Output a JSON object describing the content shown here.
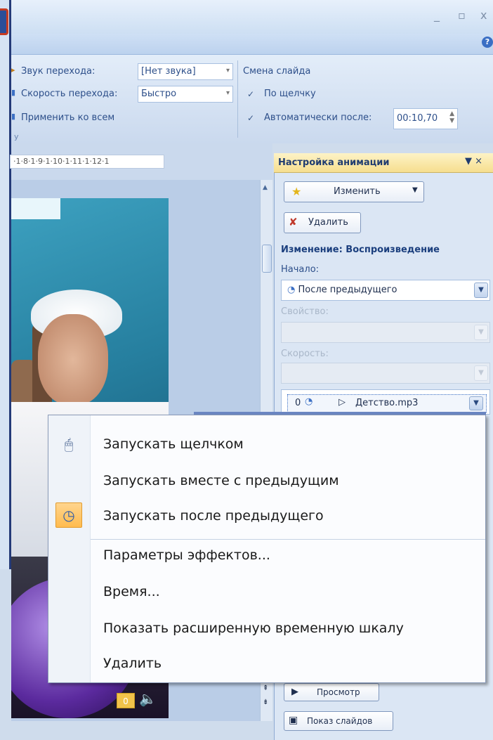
{
  "window": {
    "minimize": "_",
    "maximize": "▫",
    "close": "x",
    "help": "?"
  },
  "ribbon": {
    "transition_sound_label": "Звук перехода:",
    "transition_sound_value": "[Нет звука]",
    "transition_speed_label": "Скорость перехода:",
    "transition_speed_value": "Быстро",
    "apply_all_label": "Применить ко всем",
    "slide_change_title": "Смена слайда",
    "on_click_label": "По щелчку",
    "on_click_checked": true,
    "auto_after_label": "Автоматически после:",
    "auto_after_checked": true,
    "auto_after_value": "00:10,70",
    "group_label_partial": "у"
  },
  "ruler": {
    "text": "·1·8·1·9·1·10·1·11·1·12·1"
  },
  "slide": {
    "sound_badge": "0"
  },
  "pane": {
    "title": "Настройка анимации",
    "change_button": "Изменить",
    "delete_button": "Удалить",
    "effect_title": "Изменение: Воспроизведение",
    "start_label": "Начало:",
    "start_value": "После предыдущего",
    "property_label": "Свойство:",
    "speed_label": "Скорость:",
    "list_item_order": "0",
    "list_item_name": "Детство.mp3",
    "play_button": "Просмотр",
    "slideshow_button": "Показ слайдов"
  },
  "context_menu": {
    "items": [
      {
        "label": "Запускать щелчком",
        "icon": "mouse-icon",
        "selected": false
      },
      {
        "label": "Запускать вместе с предыдущим",
        "icon": "",
        "selected": false
      },
      {
        "label": "Запускать после предыдущего",
        "icon": "clock-icon",
        "selected": true
      },
      {
        "label": "Параметры эффектов...",
        "icon": "",
        "selected": false
      },
      {
        "label": "Время...",
        "icon": "",
        "selected": false
      },
      {
        "label": "Показать расширенную временную шкалу",
        "icon": "",
        "selected": false
      },
      {
        "label": "Удалить",
        "icon": "",
        "selected": false
      }
    ]
  }
}
